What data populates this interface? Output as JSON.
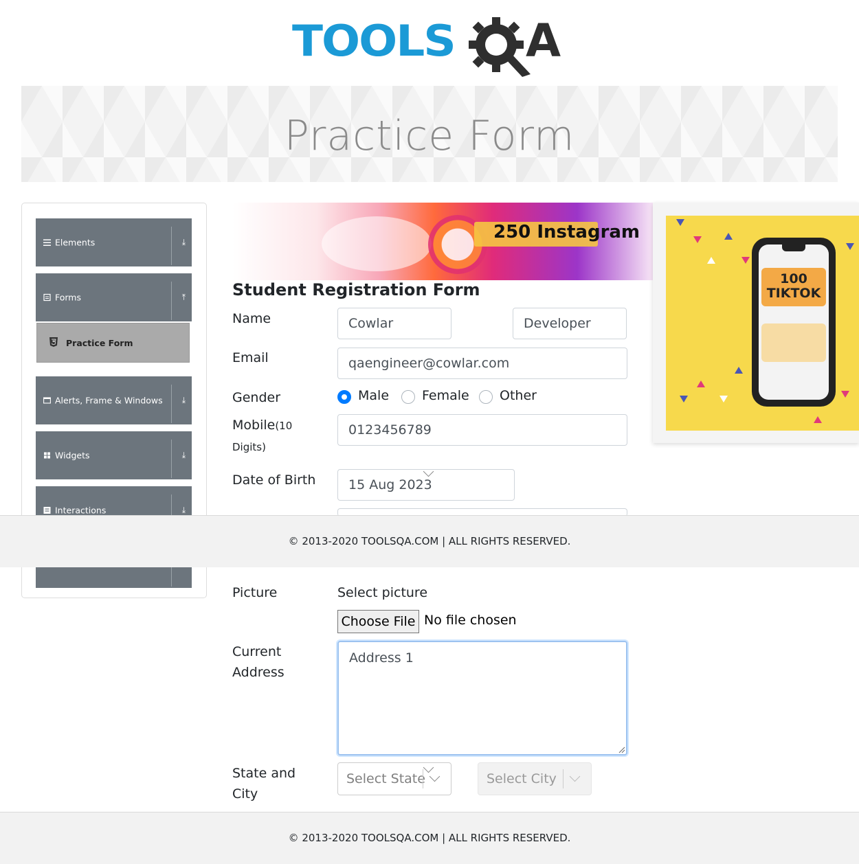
{
  "logo": {
    "text_tools": "TOOLS",
    "text_a": "A"
  },
  "banner": {
    "title": "Practice Form"
  },
  "menu": {
    "groups": [
      {
        "label": "Elements",
        "icon": "hamburger-icon",
        "arrow": "⤓"
      },
      {
        "label": "Forms",
        "icon": "form-icon",
        "arrow": "⤒"
      },
      {
        "label": "Alerts, Frame & Windows",
        "icon": "window-icon",
        "arrow": "⤓"
      },
      {
        "label": "Widgets",
        "icon": "widgets-icon",
        "arrow": "⤓"
      },
      {
        "label": "Interactions",
        "icon": "interactions-icon",
        "arrow": "⤓"
      }
    ],
    "active_item": "Practice Form"
  },
  "ads": {
    "ad1_text": "250 Instagram",
    "ad2_text_line1": "100",
    "ad2_text_line2": "TIKTOK",
    "colors": {
      "ad2_bg": "#f7d94c",
      "ad_pink": "#e02b7a"
    }
  },
  "form": {
    "title": "Student Registration Form",
    "name_label": "Name",
    "first_name": "Cowlar",
    "last_name": "Developer",
    "email_label": "Email",
    "email": "qaengineer@cowlar.com",
    "gender_label": "Gender",
    "genders": [
      "Male",
      "Female",
      "Other"
    ],
    "selected_gender": "Male",
    "mobile_label": "Mobile",
    "mobile_hint": "(10",
    "mobile_hint2": "Digits)",
    "mobile": "0123456789",
    "dob_label": "Date of Birth",
    "dob": "15 Aug 2023",
    "picture_label": "Picture",
    "select_picture": "Select picture",
    "choose_file": "Choose File",
    "no_file": "No file chosen",
    "address_label1": "Current",
    "address_label2": "Address",
    "address": "Address 1",
    "state_city_label1": "State and",
    "state_city_label2": "City",
    "state_placeholder": "Select State",
    "city_placeholder": "Select City"
  },
  "footer": {
    "text": "© 2013-2020 TOOLSQA.COM | ALL RIGHTS RESERVED."
  },
  "colors": {
    "accent": "#007bff",
    "menu_bg": "#6c757d",
    "logo_blue": "#1b9ad6"
  }
}
